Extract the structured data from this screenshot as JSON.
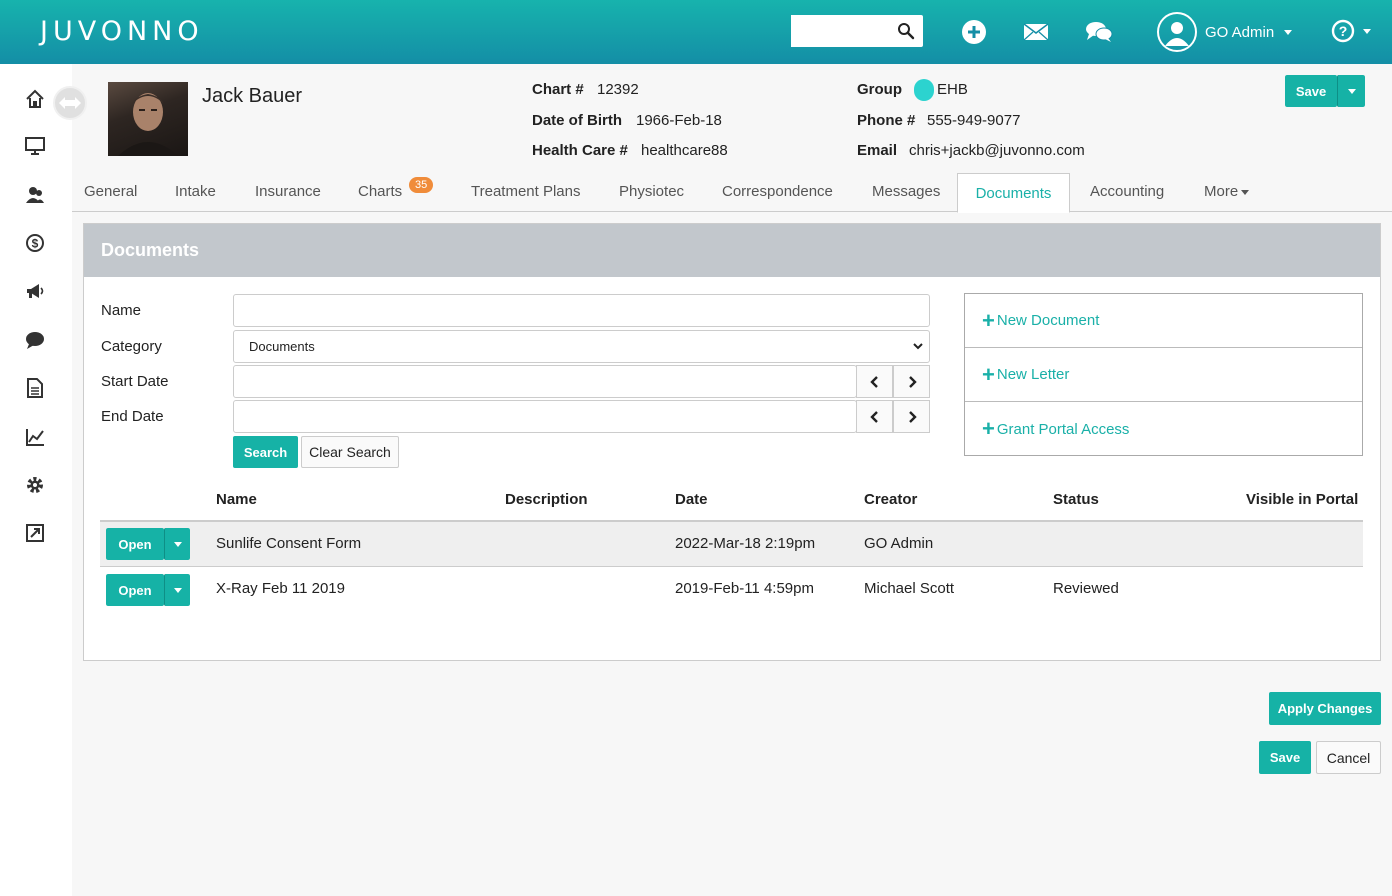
{
  "app": {
    "logo": "JUVONNO",
    "brand_color": "#16b2a6"
  },
  "topbar": {
    "search_placeholder": "",
    "icons": [
      "search-icon",
      "add-icon",
      "mail-icon",
      "chat-icon",
      "user-icon",
      "help-icon"
    ],
    "user_name": "GO Admin"
  },
  "sidebar": {
    "items": [
      "home-icon",
      "monitor-icon",
      "users-icon",
      "billing-icon",
      "megaphone-icon",
      "message-icon",
      "document-icon",
      "chart-icon",
      "gear-icon",
      "external-link-icon"
    ]
  },
  "patient": {
    "name": "Jack Bauer",
    "chart_label": "Chart #",
    "chart_value": "12392",
    "dob_label": "Date of Birth",
    "dob_value": "1966-Feb-18",
    "healthcare_label": "Health Care #",
    "healthcare_value": "healthcare88",
    "group_label": "Group",
    "group_value": "EHB",
    "group_color": "#2cd3cf",
    "phone_label": "Phone #",
    "phone_value": "555-949-9077",
    "email_label": "Email",
    "email_value": "chris+jackb@juvonno.com",
    "save_label": "Save"
  },
  "tabs": [
    {
      "label": "General"
    },
    {
      "label": "Intake"
    },
    {
      "label": "Insurance"
    },
    {
      "label": "Charts",
      "badge": "35"
    },
    {
      "label": "Treatment Plans"
    },
    {
      "label": "Physiotec"
    },
    {
      "label": "Correspondence"
    },
    {
      "label": "Messages"
    },
    {
      "label": "Documents",
      "active": true
    },
    {
      "label": "Accounting"
    },
    {
      "label": "More"
    }
  ],
  "documents": {
    "title": "Documents",
    "form": {
      "name_label": "Name",
      "name_value": "",
      "category_label": "Category",
      "category_value": "Documents",
      "start_label": "Start Date",
      "start_value": "",
      "end_label": "End Date",
      "end_value": "",
      "search_label": "Search",
      "clear_label": "Clear Search"
    },
    "actions": [
      "New Document",
      "New Letter",
      "Grant Portal Access"
    ],
    "columns": [
      "Name",
      "Description",
      "Date",
      "Creator",
      "Status",
      "Visible in Portal"
    ],
    "open_label": "Open",
    "rows": [
      {
        "name": "Sunlife Consent Form",
        "description": "",
        "date": "2022-Mar-18 2:19pm",
        "creator": "GO Admin",
        "status": "",
        "visible": ""
      },
      {
        "name": "X-Ray Feb 11 2019",
        "description": "",
        "date": "2019-Feb-11 4:59pm",
        "creator": "Michael Scott",
        "status": "Reviewed",
        "visible": ""
      }
    ]
  },
  "footer": {
    "apply_label": "Apply Changes",
    "save_label": "Save",
    "cancel_label": "Cancel"
  }
}
